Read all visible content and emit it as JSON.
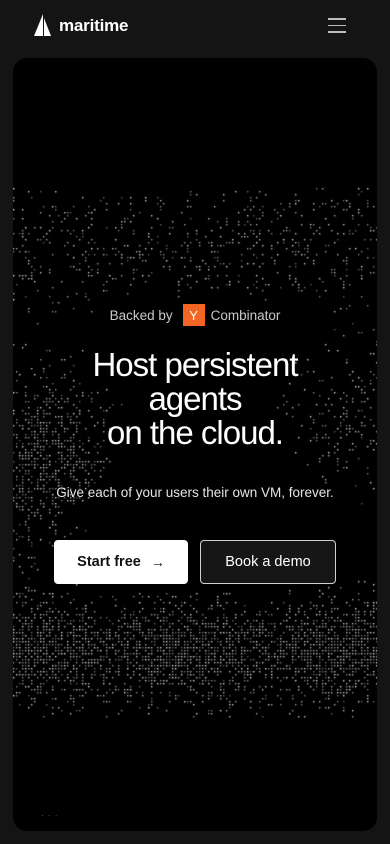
{
  "header": {
    "brand": "maritime",
    "menu_icon": "hamburger-menu-icon"
  },
  "hero": {
    "backed_prefix": "Backed by",
    "yc_letter": "Y",
    "yc_name": "Combinator",
    "headline_lines": [
      "Host persistent",
      "agents",
      "on the cloud."
    ],
    "subline": "Give each of your users their own VM, forever.",
    "primary_button": "Start free",
    "primary_arrow": "→",
    "secondary_button": "Book a demo"
  },
  "colors": {
    "page_bg": "#141414",
    "card_bg": "#000000",
    "yc_orange": "#f26522",
    "primary_bg": "#ffffff",
    "secondary_bg": "#161616"
  }
}
